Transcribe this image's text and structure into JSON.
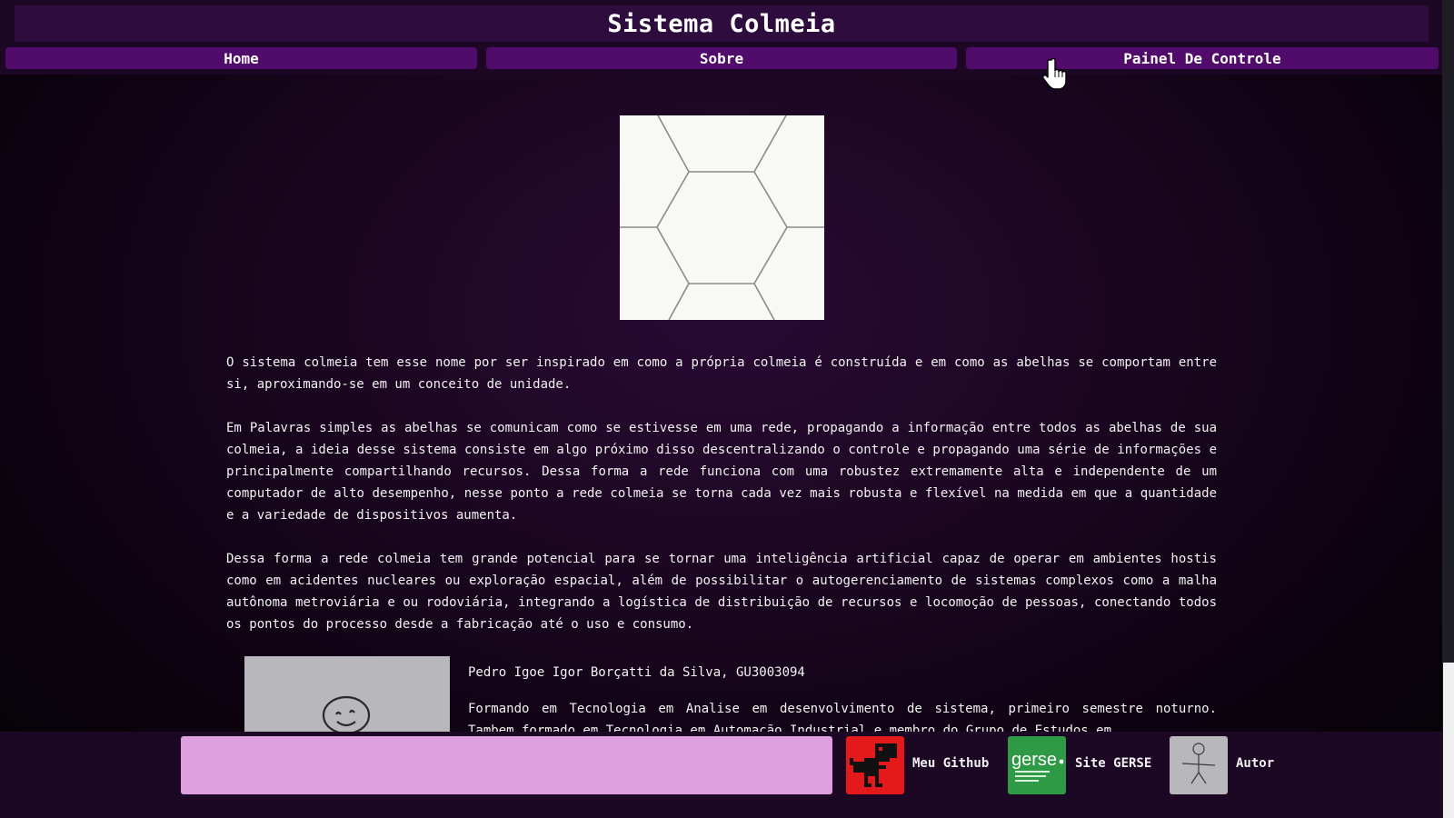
{
  "header": {
    "title": "Sistema Colmeia"
  },
  "nav": {
    "items": [
      {
        "label": "Home"
      },
      {
        "label": "Sobre"
      },
      {
        "label": "Painel De Controle"
      }
    ]
  },
  "main": {
    "image_icon": "honeycomb-hexagon-pattern",
    "paragraphs": [
      "O sistema colmeia tem esse nome por ser inspirado em como a própria colmeia é construída e em como as abelhas se comportam entre si, aproximando-se em um conceito de unidade.",
      "Em Palavras simples as abelhas se comunicam como se estivesse em uma rede, propagando a informação entre todos as abelhas de sua colmeia, a ideia desse sistema consiste em algo próximo disso descentralizando o controle e propagando uma série de informações e principalmente compartilhando recursos. Dessa forma a rede funciona com uma robustez extremamente alta e independente de um computador de alto desempenho, nesse ponto a rede colmeia se torna cada vez mais robusta e flexível na medida em que a quantidade e a variedade de dispositivos aumenta.",
      "Dessa forma a rede colmeia tem grande potencial para se tornar uma inteligência artificial capaz de operar em ambientes hostis como em acidentes nucleares ou exploração espacial, além de possibilitar o autogerenciamento de sistemas complexos como a malha autônoma metroviária e ou rodoviária, integrando a logística de distribuição de recursos e locomoção de pessoas, conectando todos os pontos do processo desde a fabricação até o uso e consumo."
    ]
  },
  "author": {
    "name": "Pedro Igoe Igor Borçatti da Silva, GU3003094",
    "bio": "Formando em Tecnologia em Analise em desenvolvimento de sistema, primeiro semestre noturno. Tambem formado em Tecnologia em Automação Industrial e membro do Grupo de Estudos em"
  },
  "footer": {
    "links": [
      {
        "label": "Meu Github",
        "icon": "pixel-dinosaur-icon"
      },
      {
        "label": "Site GERSE",
        "icon": "gerse-logo",
        "logo_text": "gerse"
      },
      {
        "label": "Autor",
        "icon": "stick-figure-icon"
      }
    ]
  },
  "colors": {
    "header_bg": "#1c0724",
    "title_bar": "#2e0c3e",
    "nav_button": "#510b6b",
    "footer_box": "#dd9fde",
    "github_thumb": "#e3191b",
    "gerse_thumb": "#2e9a45"
  }
}
